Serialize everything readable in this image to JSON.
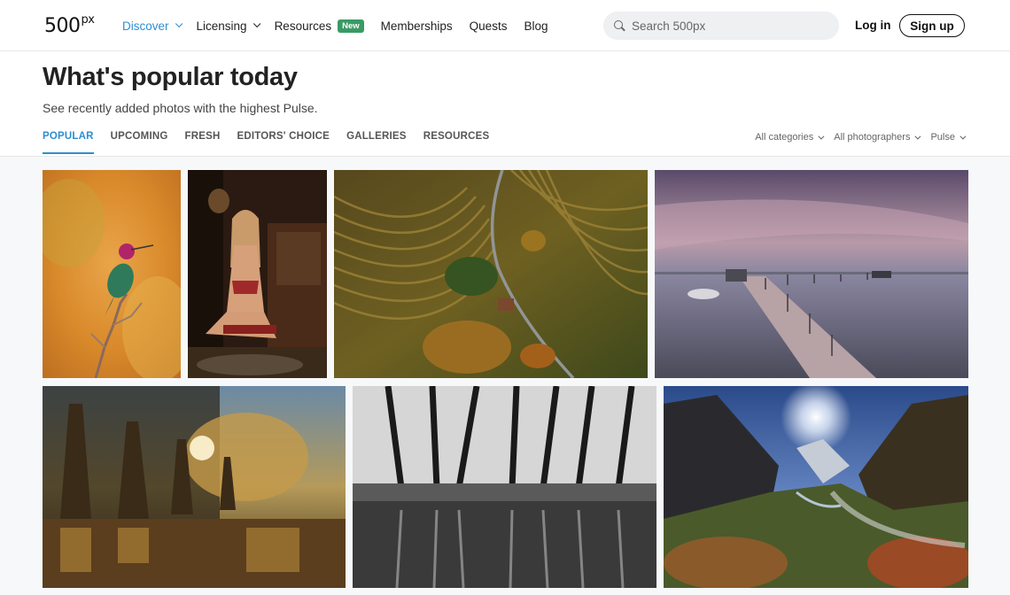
{
  "brand": {
    "logo_main": "500",
    "logo_sup": "px"
  },
  "nav": {
    "discover": "Discover",
    "licensing": "Licensing",
    "resources": "Resources",
    "resources_badge": "New",
    "memberships": "Memberships",
    "quests": "Quests",
    "blog": "Blog"
  },
  "search": {
    "placeholder": "Search 500px",
    "value": ""
  },
  "auth": {
    "login": "Log in",
    "signup": "Sign up"
  },
  "page": {
    "title": "What's popular today",
    "subtitle": "See recently added photos with the highest Pulse."
  },
  "tabs": [
    {
      "label": "POPULAR",
      "active": true
    },
    {
      "label": "UPCOMING"
    },
    {
      "label": "FRESH"
    },
    {
      "label": "EDITORS' CHOICE"
    },
    {
      "label": "GALLERIES"
    },
    {
      "label": "RESOURCES"
    }
  ],
  "filters": {
    "category": "All categories",
    "photographers": "All photographers",
    "sort": "Pulse"
  },
  "photos": [
    {
      "subject": "hummingbird on branch"
    },
    {
      "subject": "portrait of woman in room"
    },
    {
      "subject": "aerial view of fields and road"
    },
    {
      "subject": "wooden pier over lake at dusk"
    },
    {
      "subject": "cypress trees in swamp"
    },
    {
      "subject": "black and white forest reflection"
    },
    {
      "subject": "mountain valley with sunburst"
    }
  ],
  "colors": {
    "accent": "#2d8ecf",
    "badge": "#3a9a64"
  }
}
